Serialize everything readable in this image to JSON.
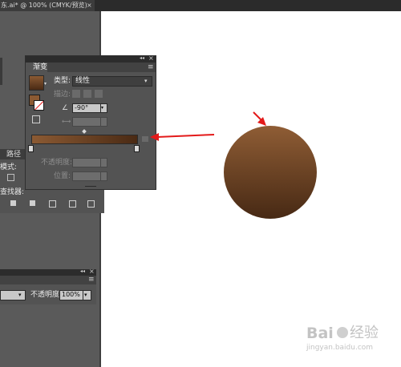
{
  "document_tab": {
    "title": "东.ai* @ 100% (CMYK/预览)",
    "close_glyph": "×"
  },
  "gradient_panel": {
    "tab_label": "渐变",
    "collapse_glyph": "◂◂",
    "close_glyph": "×",
    "menu_glyph": "≡",
    "type_label": "类型:",
    "type_value": "线性",
    "stroke_label": "描边:",
    "angle_value": "-90°",
    "opacity_label": "不透明度:",
    "location_label": "位置:",
    "start_color": "#8b5a33",
    "end_color": "#4a2a14"
  },
  "transparency_panel": {
    "mode_label": "模式:",
    "tab_label": "路径",
    "pathfinder_label": "查找器:"
  },
  "layers_panel": {
    "opacity_label": "不透明度",
    "opacity_value": "100%"
  },
  "canvas": {
    "circle_top_color": "#8f5d35",
    "circle_bottom_color": "#472914",
    "arrow_color": "#e31a1a"
  },
  "watermark": {
    "brand_text": "Bai",
    "brand_suffix": "经验",
    "url": "jingyan.baidu.com"
  }
}
